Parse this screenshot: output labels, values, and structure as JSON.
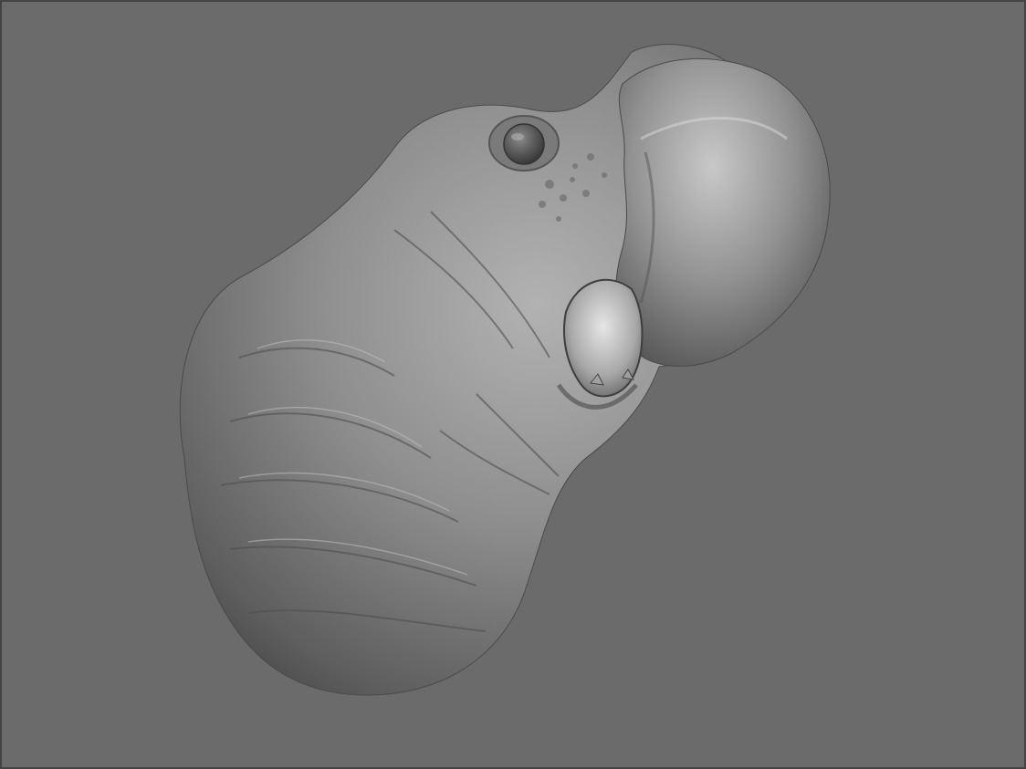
{
  "viewport": {
    "background_color": "#6b6b6b",
    "border_color": "#444444"
  },
  "model": {
    "subject": "sculpted-creature-head-icon",
    "material_color": "#8c8c8c",
    "eye_color": "#5a5a5a",
    "mouth_interior_color": "#c8c8c8"
  }
}
